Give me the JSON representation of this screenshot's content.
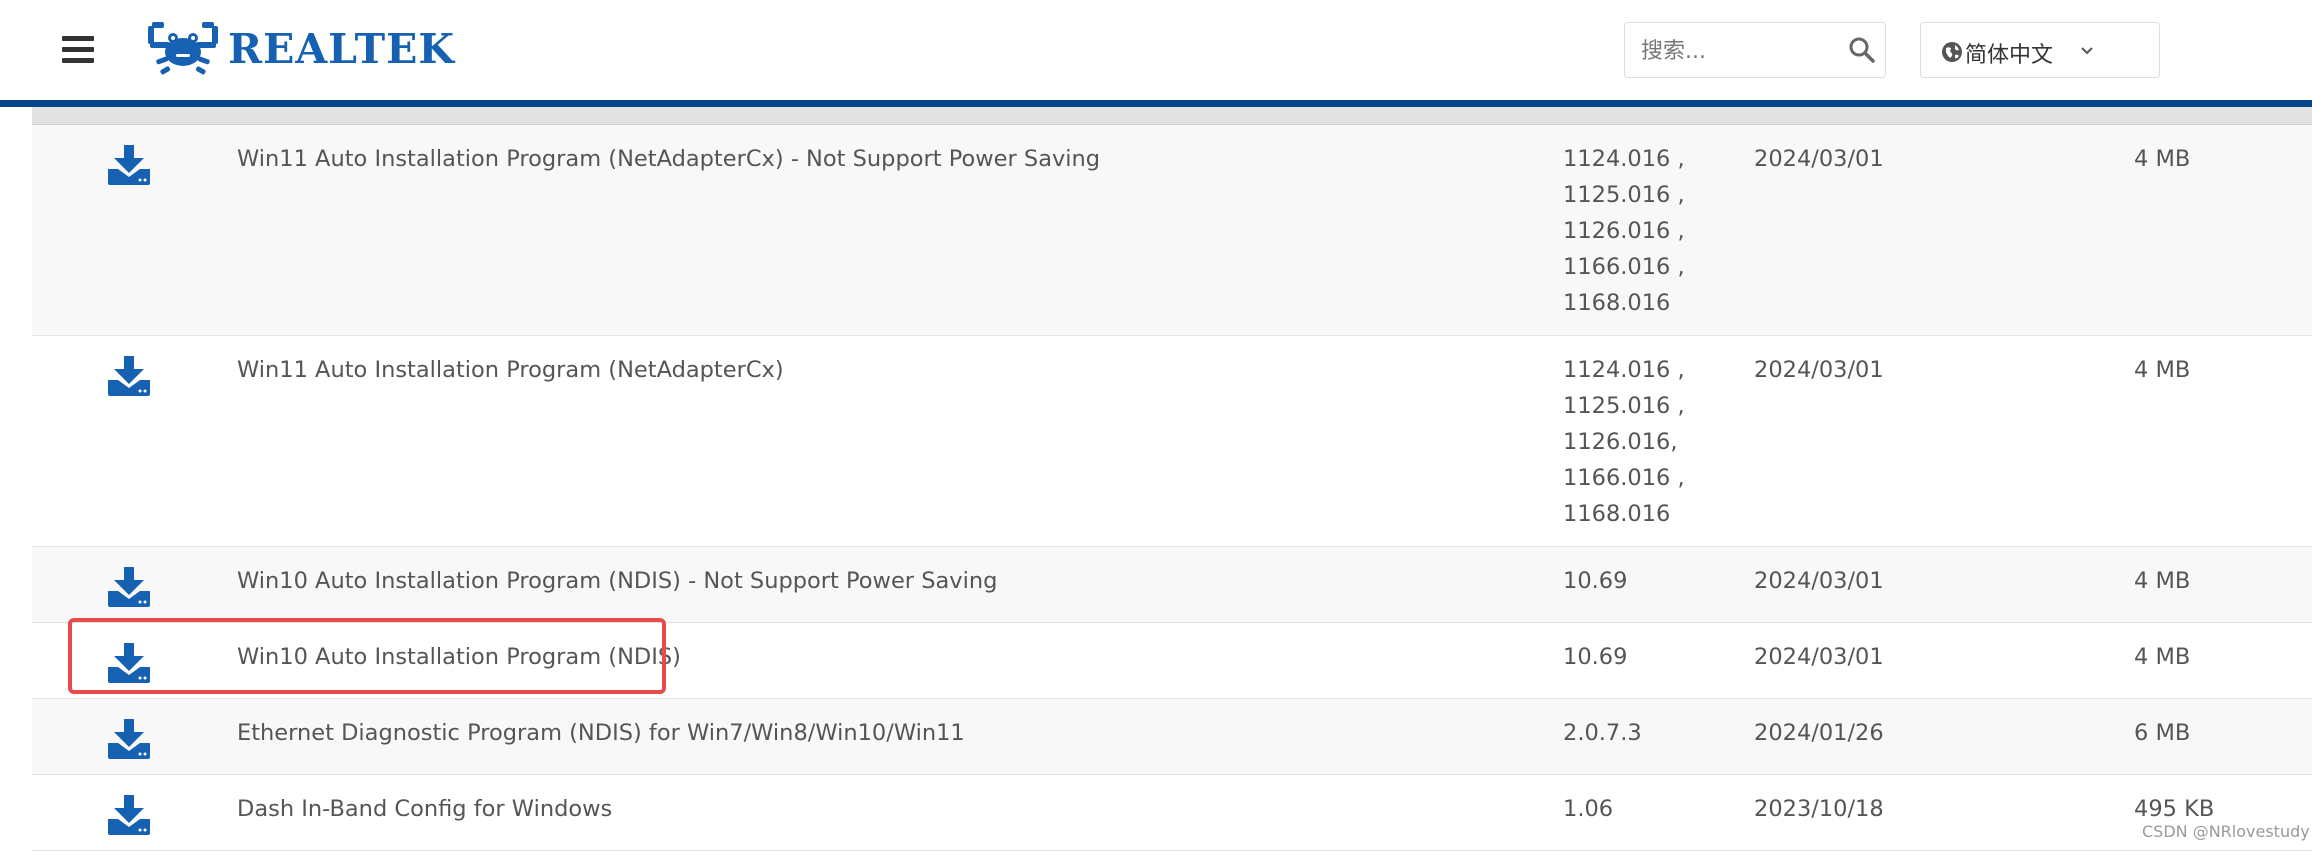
{
  "header": {
    "brand": "REALTEK",
    "search_placeholder": "搜索...",
    "language": "简体中文"
  },
  "rows": [
    {
      "description": "Win11 Auto Installation Program (NetAdapterCx) - Not Support Power Saving",
      "version_lines": [
        "1124.016 ,",
        "1125.016 ,",
        "1126.016 ,",
        "1166.016 ,",
        "1168.016"
      ],
      "date": "2024/03/01",
      "size": "4 MB"
    },
    {
      "description": "Win11 Auto Installation Program (NetAdapterCx)",
      "version_lines": [
        "1124.016 ,",
        "1125.016 ,",
        "1126.016,",
        "1166.016 ,",
        "1168.016"
      ],
      "date": "2024/03/01",
      "size": "4 MB"
    },
    {
      "description": "Win10 Auto Installation Program (NDIS) - Not Support Power Saving",
      "version_lines": [
        "10.69"
      ],
      "date": "2024/03/01",
      "size": "4 MB"
    },
    {
      "description": "Win10 Auto Installation Program (NDIS)",
      "version_lines": [
        "10.69"
      ],
      "date": "2024/03/01",
      "size": "4 MB"
    },
    {
      "description": "Ethernet Diagnostic Program (NDIS) for Win7/Win8/Win10/Win11",
      "version_lines": [
        "2.0.7.3"
      ],
      "date": "2024/01/26",
      "size": "6 MB"
    },
    {
      "description": "Dash In-Band Config for Windows",
      "version_lines": [
        "1.06"
      ],
      "date": "2023/10/18",
      "size": "495 KB"
    }
  ],
  "watermark": "CSDN @NRlovestudy",
  "colors": {
    "brand_blue": "#1661b1",
    "header_bar": "#07468a",
    "highlight_red": "#e84b4b"
  }
}
